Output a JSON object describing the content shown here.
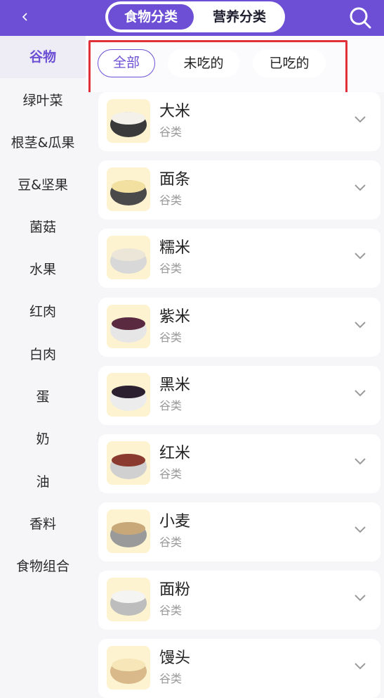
{
  "header": {
    "tabs": [
      {
        "label": "食物分类",
        "active": true
      },
      {
        "label": "营养分类",
        "active": false
      }
    ],
    "back_icon": "chevron-left-icon",
    "search_icon": "search-icon",
    "accent_color": "#6c4fd4"
  },
  "sidebar": {
    "items": [
      {
        "label": "谷物",
        "active": true
      },
      {
        "label": "绿叶菜"
      },
      {
        "label": "根茎&瓜果"
      },
      {
        "label": "豆&坚果"
      },
      {
        "label": "菌菇"
      },
      {
        "label": "水果"
      },
      {
        "label": "红肉"
      },
      {
        "label": "白肉"
      },
      {
        "label": "蛋"
      },
      {
        "label": "奶"
      },
      {
        "label": "油"
      },
      {
        "label": "香料"
      },
      {
        "label": "食物组合"
      }
    ]
  },
  "filters": {
    "chips": [
      {
        "label": "全部",
        "selected": true
      },
      {
        "label": "未吃的"
      },
      {
        "label": "已吃的"
      }
    ]
  },
  "foods": [
    {
      "name": "大米",
      "category": "谷类",
      "grain_color": "#f3f1ea",
      "bowl_color": "#3a3a3a"
    },
    {
      "name": "面条",
      "category": "谷类",
      "grain_color": "#f2e0a0",
      "bowl_color": "#4a4a4a"
    },
    {
      "name": "糯米",
      "category": "谷类",
      "grain_color": "#ece6d8",
      "bowl_color": "#d8d8d8"
    },
    {
      "name": "紫米",
      "category": "谷类",
      "grain_color": "#5a2a40",
      "bowl_color": "#e6e6e6"
    },
    {
      "name": "黑米",
      "category": "谷类",
      "grain_color": "#2a2030",
      "bowl_color": "#ececec"
    },
    {
      "name": "红米",
      "category": "谷类",
      "grain_color": "#8a3a2e",
      "bowl_color": "#d0d0d0"
    },
    {
      "name": "小麦",
      "category": "谷类",
      "grain_color": "#c8a878",
      "bowl_color": "#9a9a9a"
    },
    {
      "name": "面粉",
      "category": "谷类",
      "grain_color": "#f4f4f2",
      "bowl_color": "#bdbdbd"
    },
    {
      "name": "馒头",
      "category": "谷类",
      "grain_color": "#f7e7b8",
      "bowl_color": "#d9b98a"
    }
  ]
}
